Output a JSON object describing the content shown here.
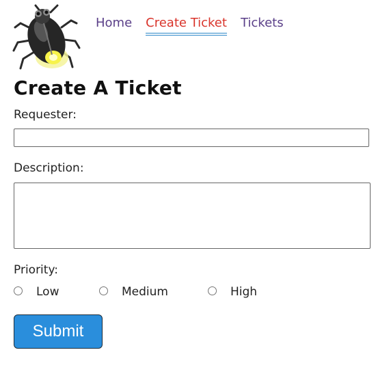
{
  "logo": {
    "icon": "firefly-bug-icon"
  },
  "nav": {
    "home": "Home",
    "create_ticket": "Create Ticket",
    "tickets": "Tickets",
    "active_color": "#d9342b",
    "link_color": "#5a3f88",
    "underline_color": "#2a86c8"
  },
  "page": {
    "title": "Create A Ticket"
  },
  "form": {
    "requester_label": "Requester:",
    "requester_value": "",
    "description_label": "Description:",
    "description_value": "",
    "priority_label": "Priority:",
    "priority_options": [
      "Low",
      "Medium",
      "High"
    ],
    "submit_label": "Submit",
    "submit_color": "#2a8edc"
  }
}
